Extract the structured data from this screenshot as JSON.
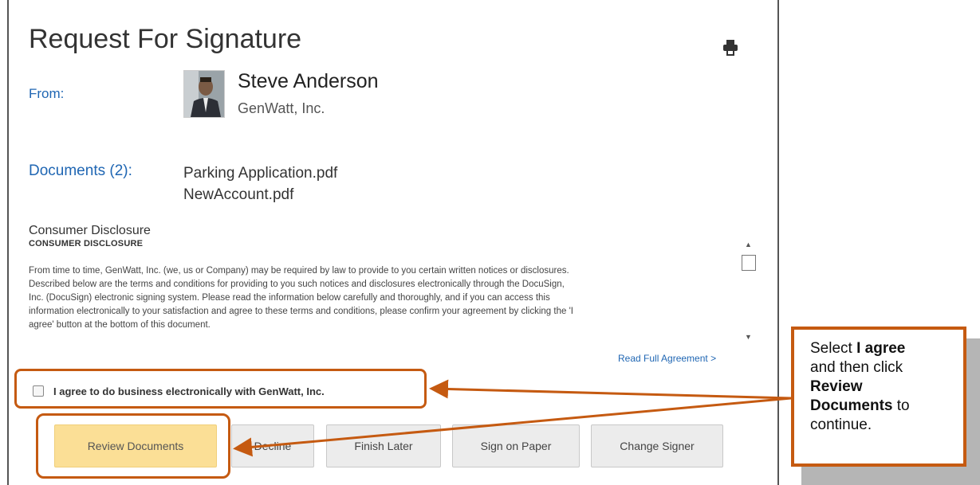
{
  "header": {
    "title": "Request For Signature",
    "print_icon": "printer-icon"
  },
  "sender": {
    "label": "From:",
    "name": "Steve Anderson",
    "company": "GenWatt, Inc."
  },
  "documents": {
    "label": "Documents (2):",
    "items": [
      "Parking Application.pdf",
      "NewAccount.pdf"
    ]
  },
  "disclosure": {
    "title": "Consumer Disclosure",
    "subtitle": "CONSUMER DISCLOSURE",
    "lines": [
      "From time to time, GenWatt, Inc. (we, us or Company) may be required by law to provide to you certain written notices or disclosures.",
      "Described below are the terms and conditions for providing to you such notices and disclosures electronically through the DocuSign,",
      "Inc. (DocuSign) electronic signing system. Please read the information below carefully and thoroughly, and if you can access this",
      "information electronically to your satisfaction and agree to these terms and conditions, please confirm your agreement by clicking the 'I",
      "agree' button at the bottom of this document."
    ],
    "read_full": "Read Full Agreement >"
  },
  "agree": {
    "label": "I agree to do business electronically with GenWatt, Inc.",
    "checked": false
  },
  "buttons": {
    "review": "Review Documents",
    "decline": "Decline",
    "finish_later": "Finish Later",
    "sign_on_paper": "Sign on Paper",
    "change_signer": "Change Signer"
  },
  "callout": {
    "line1_pre": "Select ",
    "line1_bold": "I agree",
    "line2": "and then click",
    "line3_bold": "Review",
    "line4_bold": "Documents",
    "line4_post": " to",
    "line5": "continue."
  },
  "colors": {
    "accent_orange": "#c55a11",
    "link_blue": "#1f66b3",
    "review_button": "#fbdf96"
  }
}
